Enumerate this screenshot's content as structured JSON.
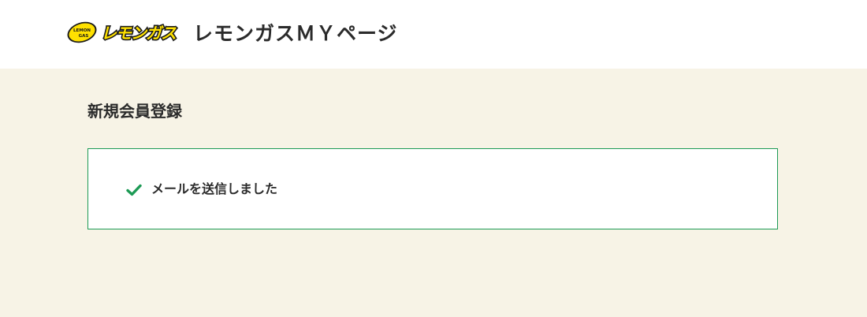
{
  "header": {
    "logo": {
      "badge_text_top": "LEMON",
      "badge_text_bottom": "GAS",
      "wordmark": "レモンガス",
      "brand_yellow": "#ffe100",
      "brand_outline": "#1a1a1a"
    },
    "site_title": "レモンガスＭＹページ"
  },
  "main": {
    "page_title": "新規会員登録",
    "message": {
      "icon": "check-icon",
      "text": "メールを送信しました",
      "border_color": "#1d9a55",
      "icon_color": "#1d9a55"
    },
    "background_color": "#f7f3e6"
  }
}
